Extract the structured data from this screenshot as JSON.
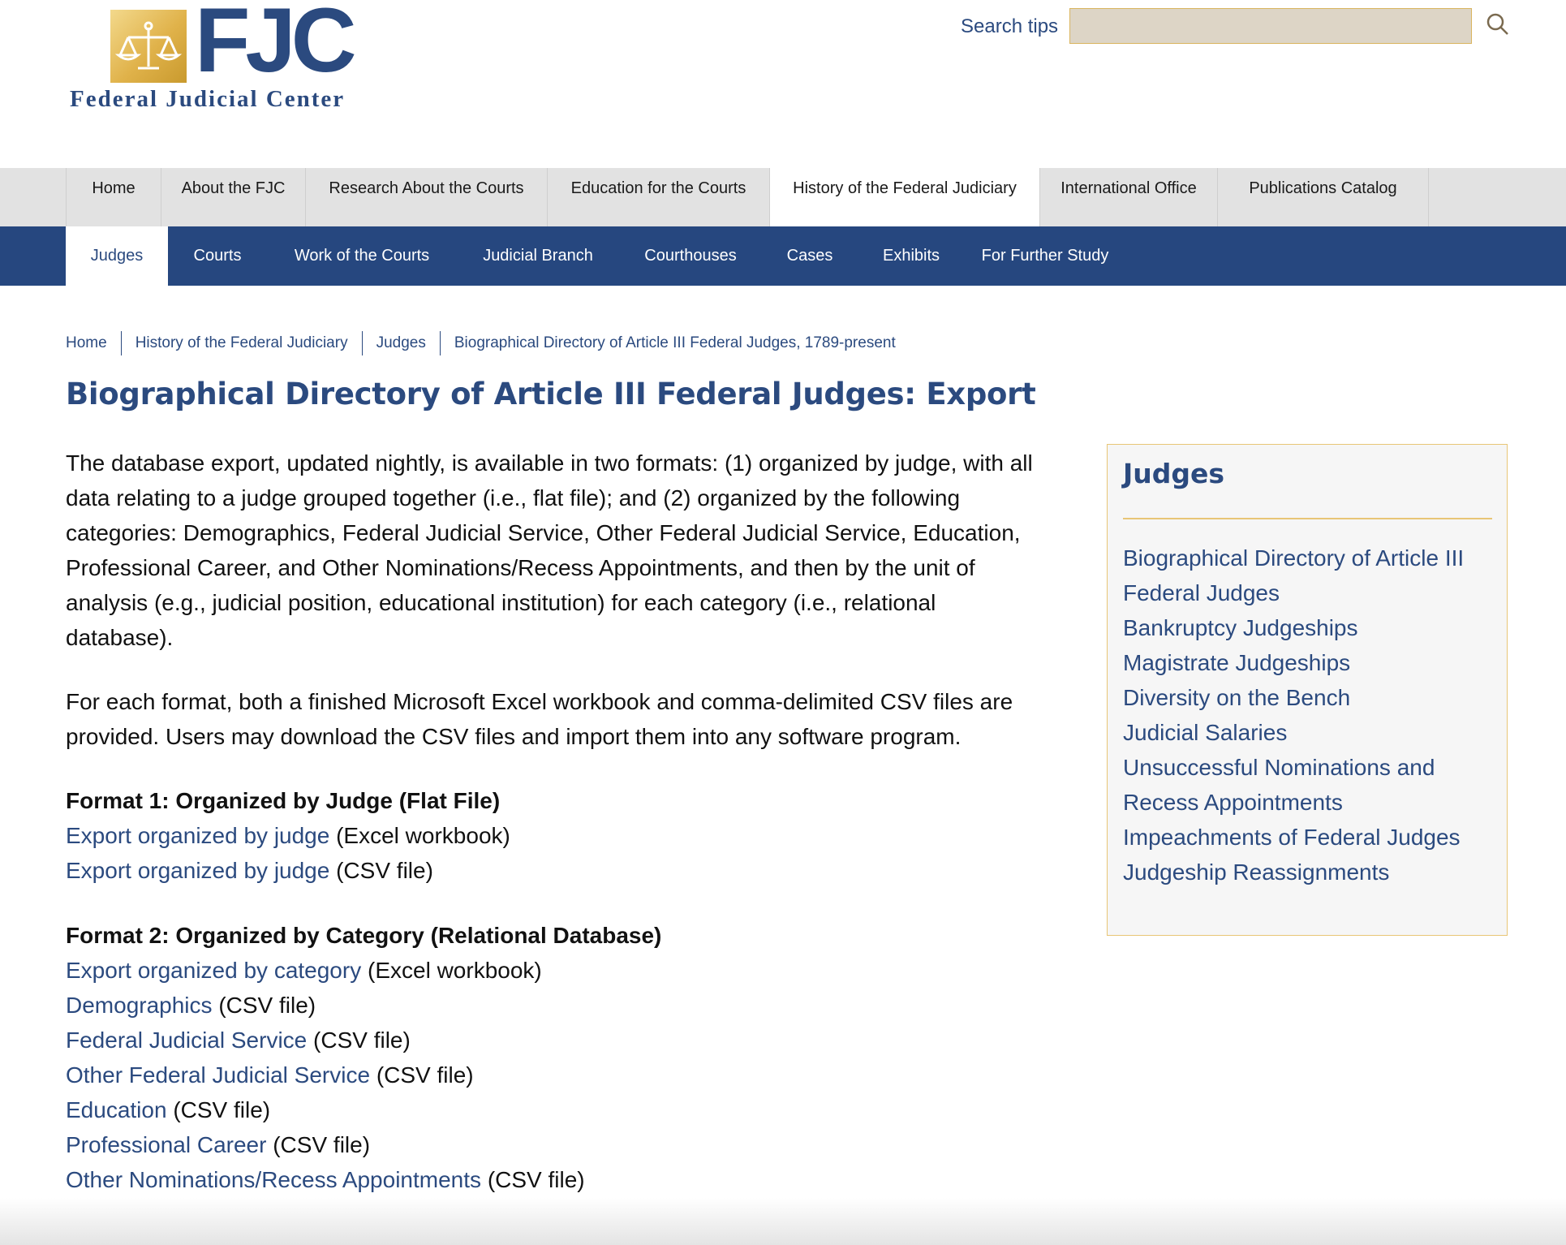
{
  "header": {
    "logo_letters": "FJC",
    "logo_tagline": "Federal Judicial Center",
    "search_tips": "Search tips",
    "search_placeholder": ""
  },
  "colors": {
    "brand_blue": "#26477f",
    "link_blue": "#2b4a7f",
    "gold_accent": "#e8c676",
    "nav_gray": "#e2e2e2"
  },
  "nav_primary": [
    {
      "label": "Home"
    },
    {
      "label": "About the FJC"
    },
    {
      "label": "Research About the Courts"
    },
    {
      "label": "Education for the Courts"
    },
    {
      "label": "History of the Federal Judiciary",
      "active": true
    },
    {
      "label": "International Office"
    },
    {
      "label": "Publications Catalog"
    }
  ],
  "nav_secondary": [
    {
      "label": "Judges",
      "active": true
    },
    {
      "label": "Courts"
    },
    {
      "label": "Work of the Courts"
    },
    {
      "label": "Judicial Branch"
    },
    {
      "label": "Courthouses"
    },
    {
      "label": "Cases"
    },
    {
      "label": "Exhibits"
    },
    {
      "label": "For Further Study"
    }
  ],
  "breadcrumb": [
    "Home",
    "History of the Federal Judiciary",
    "Judges",
    "Biographical Directory of Article III Federal Judges, 1789-present"
  ],
  "page_title": "Biographical Directory of Article III Federal Judges: Export",
  "intro": {
    "paragraph1": "The database export, updated nightly, is available in two formats: (1) organized by judge, with all data relating to a judge grouped together (i.e., flat file); and (2) organized by the following categories: Demographics, Federal Judicial Service, Other Federal Judicial Service, Education, Professional Career, and Other Nominations/Recess Appointments, and then by the unit of analysis (e.g., judicial position, educational institution) for each category (i.e., relational database).",
    "paragraph2": "For each format, both a finished Microsoft Excel workbook and comma-delimited CSV files are provided. Users may download the CSV files and import them into any software program."
  },
  "format1": {
    "heading": "Format 1: Organized by Judge (Flat File)",
    "items": [
      {
        "link": "Export organized by judge",
        "suffix": "(Excel workbook)"
      },
      {
        "link": "Export organized by judge",
        "suffix": "(CSV file)"
      }
    ]
  },
  "format2": {
    "heading": "Format 2: Organized by Category (Relational Database)",
    "items": [
      {
        "link": "Export organized by category",
        "suffix": "(Excel workbook)"
      },
      {
        "link": "Demographics",
        "suffix": "(CSV file)"
      },
      {
        "link": "Federal Judicial Service",
        "suffix": "(CSV file)"
      },
      {
        "link": "Other Federal Judicial Service",
        "suffix": "(CSV file)"
      },
      {
        "link": "Education",
        "suffix": "(CSV file)"
      },
      {
        "link": "Professional Career",
        "suffix": "(CSV file)"
      },
      {
        "link": "Other Nominations/Recess Appointments",
        "suffix": "(CSV file)"
      }
    ]
  },
  "sidebar": {
    "title": "Judges",
    "lines": [
      "Biographical Directory of Article III",
      "Federal Judges",
      "Bankruptcy Judgeships",
      "Magistrate Judgeships",
      "Diversity on the Bench",
      "Judicial Salaries",
      "Unsuccessful Nominations and",
      "Recess Appointments",
      "Impeachments of Federal Judges",
      "Judgeship Reassignments"
    ]
  }
}
